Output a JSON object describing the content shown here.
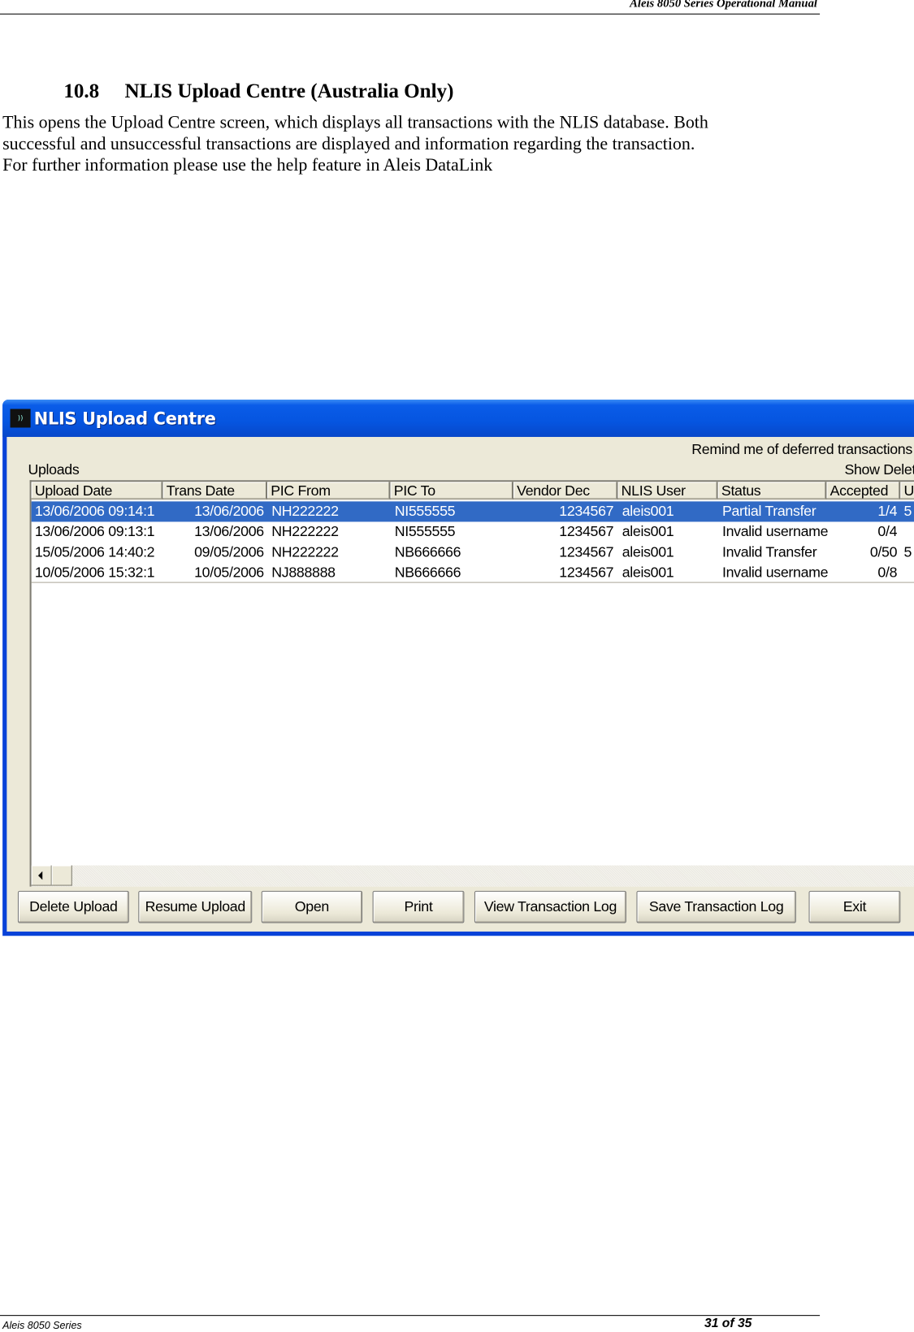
{
  "header": {
    "title": "Aleis 8050 Series Operational Manual"
  },
  "section": {
    "number": "10.8",
    "title": "NLIS Upload Centre (Australia Only)"
  },
  "body_lines": [
    "This opens the Upload Centre screen, which displays all transactions with the NLIS database. Both",
    "successful and unsuccessful transactions are displayed and information regarding the transaction.",
    "For further information please use the help feature in Aleis DataLink"
  ],
  "window": {
    "title": "NLIS Upload Centre",
    "icon": "aleis-logo-icon",
    "remind_label": "Remind me of deferred transactions",
    "show_deleted_label": "Show Delet",
    "uploads_label": "Uploads",
    "columns": [
      "Upload Date",
      "Trans Date",
      "PIC From",
      "PIC To",
      "Vendor Dec",
      "NLIS User",
      "Status",
      "Accepted",
      "U"
    ],
    "rows": [
      [
        "13/06/2006 09:14:1",
        "13/06/2006",
        "NH222222",
        "NI555555",
        "1234567",
        "aleis001",
        "Partial Transfer",
        "1/4",
        "5"
      ],
      [
        "13/06/2006 09:13:1",
        "13/06/2006",
        "NH222222",
        "NI555555",
        "1234567",
        "aleis001",
        "Invalid username",
        "0/4",
        ""
      ],
      [
        "15/05/2006 14:40:2",
        "09/05/2006",
        "NH222222",
        "NB666666",
        "1234567",
        "aleis001",
        "Invalid Transfer",
        "0/50",
        "5"
      ],
      [
        "10/05/2006 15:32:1",
        "10/05/2006",
        "NJ888888",
        "NB666666",
        "1234567",
        "aleis001",
        "Invalid username",
        "0/8",
        ""
      ]
    ],
    "selected_row": 0,
    "buttons": [
      "Delete Upload",
      "Resume Upload",
      "Open",
      "Print",
      "View Transaction Log",
      "Save Transaction Log",
      "Exit"
    ],
    "colors": {
      "titlebar": "#0555e0",
      "selection": "#316ac5",
      "face": "#ece9d8"
    }
  },
  "footer": {
    "left": "Aleis 8050 Series",
    "page": "31 of 35"
  }
}
